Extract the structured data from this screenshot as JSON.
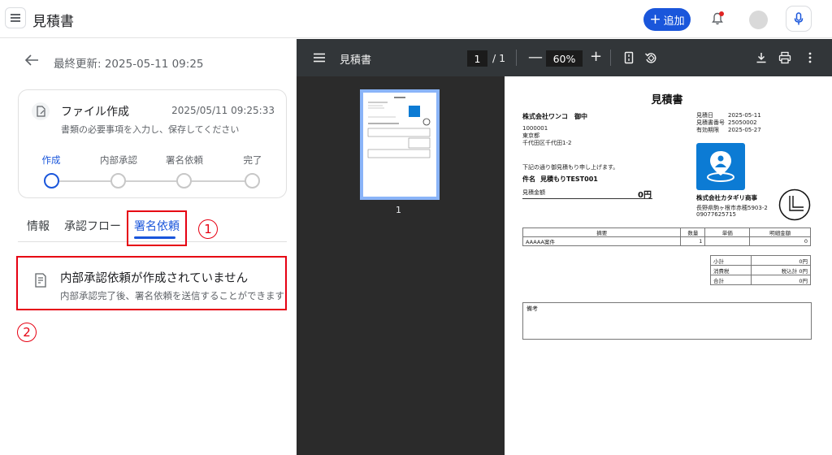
{
  "header": {
    "title": "見積書",
    "add_label": "追加",
    "add_plus": "+"
  },
  "left": {
    "last_updated": "最終更新: 2025-05-11 09:25",
    "card": {
      "title": "ファイル作成",
      "time": "2025/05/11 09:25:33",
      "desc": "書類の必要事項を入力し、保存してください",
      "steps": [
        {
          "label": "作成",
          "active": true
        },
        {
          "label": "内部承認",
          "active": false
        },
        {
          "label": "署名依頼",
          "active": false
        },
        {
          "label": "完了",
          "active": false
        }
      ]
    },
    "tabs": [
      {
        "label": "情報"
      },
      {
        "label": "承認フロー"
      },
      {
        "label": "署名依頼"
      }
    ],
    "markers": {
      "one": "1",
      "two": "2"
    },
    "notice": {
      "title": "内部承認依頼が作成されていません",
      "desc": "内部承認完了後、署名依頼を送信することができます"
    }
  },
  "viewer": {
    "title": "見積書",
    "page_current": "1",
    "page_of": "/  1",
    "zoom": "60%",
    "minus": "—",
    "plus": "+",
    "thumb_number": "1"
  },
  "doc": {
    "title": "見積書",
    "client": "株式会社ワンコ　御中",
    "client_zip": "1000001",
    "client_pref": "東京都",
    "client_addr": "千代田区千代田1-2",
    "date_label": "見積日",
    "date_value": "2025-05-11",
    "number_label": "見積書番号",
    "number_value": "25050002",
    "expiry_label": "有効期限",
    "expiry_value": "2025-05-27",
    "intro": "下記の通り御見積もり申し上げます。",
    "subject_label": "件名",
    "subject_value": "見積もりTEST001",
    "amount_label": "見積金額",
    "amount_value": "0円",
    "issuer": "株式会社カタギリ商事",
    "issuer_addr": "長野県駒ヶ根市赤穂5903-2",
    "issuer_tel": "09077625715",
    "table_headers": [
      "摘要",
      "数量",
      "単価",
      "明細金額"
    ],
    "table_rows": [
      [
        "AAAAA案件",
        "1",
        "",
        "0"
      ]
    ],
    "totals": [
      {
        "label": "小計",
        "value": "0円"
      },
      {
        "label": "消費税",
        "value": "税込計 0円"
      },
      {
        "label": "合計",
        "value": "0円"
      }
    ],
    "remarks_label": "備考"
  },
  "colors": {
    "accent": "#1a56db",
    "annotation_red": "#e60012",
    "viewer_bg": "#2b2b2b",
    "viewer_bar": "#323639"
  }
}
